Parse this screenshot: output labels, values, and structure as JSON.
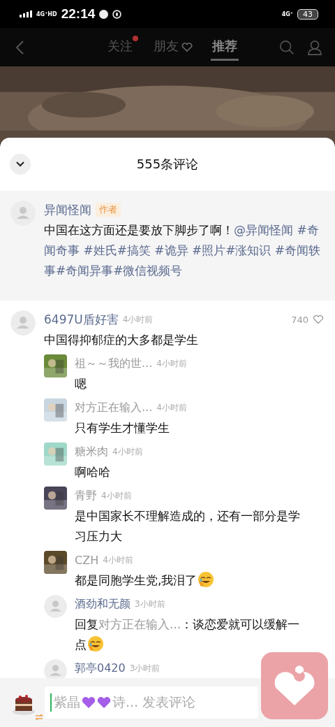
{
  "status_bar": {
    "network": "4G⁺HD",
    "time": "22:14",
    "network_right": "4G⁺",
    "battery": "43"
  },
  "nav": {
    "tabs": [
      {
        "label": "关注",
        "selected": false,
        "dot": true
      },
      {
        "label": "朋友",
        "selected": false,
        "heart": true
      },
      {
        "label": "推荐",
        "selected": true
      }
    ]
  },
  "comments_header": {
    "title": "555条评论"
  },
  "author_comment": {
    "name": "异闻怪闻",
    "badge": "作者",
    "text": "中国在这方面还是要放下脚步了啊！",
    "tags": "@异闻怪闻 #奇闻奇事 #姓氏#搞笑 #诡异 #照片#涨知识 #奇闻轶事#奇闻异事#微信视频号"
  },
  "comments": [
    {
      "name": "6497U盾好害",
      "time": "4小时前",
      "text": "中国得抑郁症的大多都是学生",
      "likes": "740",
      "kind": "default",
      "replies": [
        {
          "kind": "picture",
          "name": "祖～～我的世...",
          "time": "4小时前",
          "text": "嗯"
        },
        {
          "kind": "picture",
          "name": "对方正在输入...",
          "time": "4小时前",
          "text": "只有学生才懂学生"
        },
        {
          "kind": "picture",
          "name": "糖米肉",
          "time": "4小时前",
          "text": "啊哈哈"
        },
        {
          "kind": "picture",
          "name": "青野",
          "time": "4小时前",
          "text": "是中国家长不理解造成的，还有一部分是学习压力大"
        },
        {
          "kind": "picture",
          "name": "CZH",
          "time": "4小时前",
          "text": "都是同胞学生党,我泪了",
          "emoji": true
        },
        {
          "kind": "default",
          "name": "酒劲和无颜",
          "time": "3小时前",
          "reply_prefix": "回复",
          "reply_to": "对方正在输入...",
          "text": "：谈恋爱就可以缓解一点",
          "emoji": true
        },
        {
          "kind": "default",
          "name": "郭亭0420",
          "time": "3小时前"
        }
      ]
    }
  ],
  "input": {
    "placeholder_parts": [
      {
        "kind": "text",
        "text": "紫晶"
      },
      {
        "kind": "heart"
      },
      {
        "kind": "heart"
      },
      {
        "kind": "text",
        "text": "诗... 发表评论"
      }
    ]
  }
}
